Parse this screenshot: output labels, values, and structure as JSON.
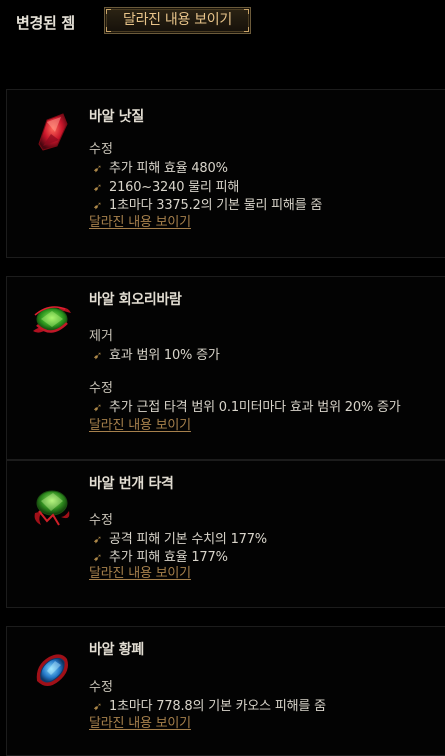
{
  "header": {
    "title": "변경된 젬",
    "show_diff_button": "달라진 내용 보이기"
  },
  "gems": [
    {
      "name": "바알 낫질",
      "icon": "red-crystal-gem-icon",
      "groups": [
        {
          "heading": "수정",
          "lines": [
            "추가 피해 효율 480%",
            "2160~3240 물리 피해",
            "1초마다 3375.2의 기본 물리 피해를 줌"
          ]
        }
      ],
      "link": "달라진 내용 보이기"
    },
    {
      "name": "바알 회오리바람",
      "icon": "green-whirl-gem-icon",
      "groups": [
        {
          "heading": "제거",
          "lines": [
            "효과 범위 10% 증가"
          ]
        },
        {
          "heading": "수정",
          "lines": [
            "추가 근접 타격 범위 0.1미터마다 효과 범위 20% 증가"
          ]
        }
      ],
      "link": "달라진 내용 보이기"
    },
    {
      "name": "바알 번개 타격",
      "icon": "green-lightning-gem-icon",
      "groups": [
        {
          "heading": "수정",
          "lines": [
            "공격 피해 기본 수치의 177%",
            "추가 피해 효율 177%"
          ]
        }
      ],
      "link": "달라진 내용 보이기"
    },
    {
      "name": "바알 황폐",
      "icon": "blue-blight-gem-icon",
      "groups": [
        {
          "heading": "수정",
          "lines": [
            "1초마다 778.8의 기본 카오스 피해를 줌"
          ]
        }
      ],
      "link": "달라진 내용 보이기"
    }
  ],
  "colors": {
    "background": "#000000",
    "link": "#a6804c",
    "bullet": "#b08a4a",
    "button_text": "#e8c48a"
  }
}
